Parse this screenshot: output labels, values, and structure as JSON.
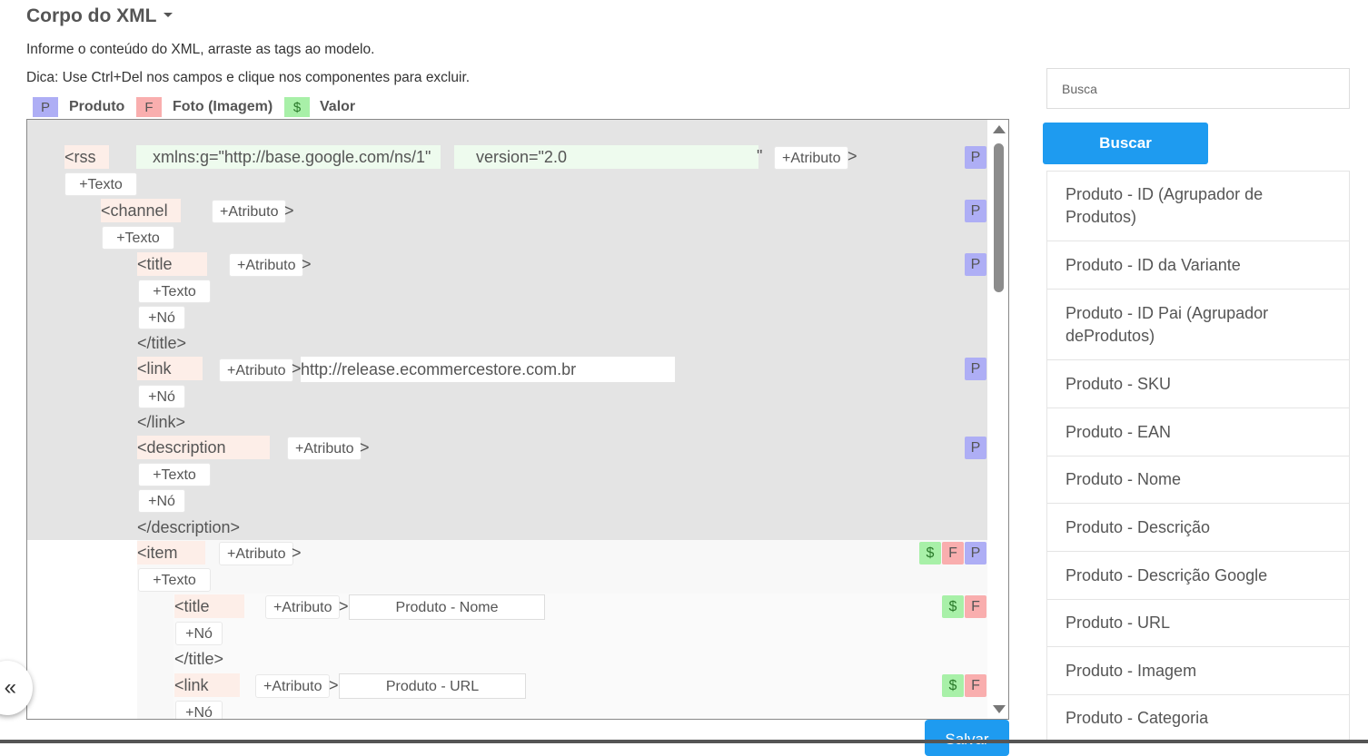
{
  "header": {
    "title": "Corpo do XML",
    "info_line": "Informe o conteúdo do XML, arraste as tags ao modelo.",
    "hint_line": "Dica: Use Ctrl+Del nos campos e clique nos componentes para excluir."
  },
  "legend": [
    {
      "letter": "P",
      "label": "Produto",
      "color": "#aeaef5"
    },
    {
      "letter": "F",
      "label": "Foto (Imagem)",
      "color": "#f9aeae"
    },
    {
      "letter": "$",
      "label": "Valor",
      "color": "#a8f0a8"
    }
  ],
  "editor": {
    "add_attr": "+Atributo",
    "add_text": "+Texto",
    "add_node": "+Nó",
    "gt": ">",
    "quote_end": "\"",
    "rss": {
      "open": "<rss",
      "attr1": "xmlns:g=\"http://base.google.com/ns/1\"",
      "attr2": "version=\"2.0"
    },
    "channel_open": "<channel",
    "title_open": "<title",
    "title_close": "</title>",
    "link_open": "<link",
    "link_value": "http://release.ecommercestore.com.br",
    "link_close": "</link>",
    "description_open": "<description",
    "description_close": "</description>",
    "item_open": "<item",
    "item_title_open": "<title",
    "item_title_value": "Produto - Nome",
    "item_title_close": "</title>",
    "item_link_open": "<link",
    "item_link_value": "Produto - URL"
  },
  "badges": {
    "p": "P",
    "f": "F",
    "v": "$"
  },
  "sidebar": {
    "search_placeholder": "Busca",
    "search_button": "Buscar",
    "items": [
      "Produto - ID (Agrupador de Produtos)",
      "Produto - ID da Variante",
      "Produto - ID Pai (Agrupador deProdutos)",
      "Produto - SKU",
      "Produto - EAN",
      "Produto - Nome",
      "Produto - Descrição",
      "Produto - Descrição Google",
      "Produto - URL",
      "Produto - Imagem",
      "Produto - Categoria"
    ]
  },
  "footer": {
    "save_button": "Salvar",
    "collapse_label": "«"
  }
}
